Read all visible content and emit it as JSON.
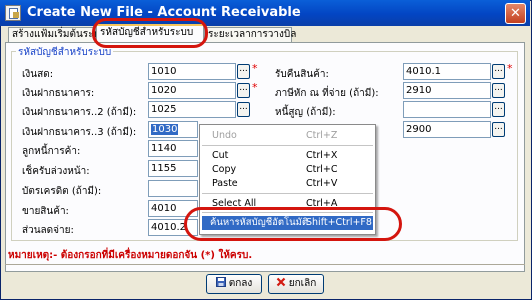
{
  "window": {
    "title": "Create New File - Account Receivable",
    "close_glyph": "✕"
  },
  "tabs": [
    {
      "label": "สร้างแฟ้มเริ่มต้นระบบ"
    },
    {
      "label": "รหัสบัญชีสำหรับระบบ"
    },
    {
      "label": "ระยะเวลาการวางบิล"
    }
  ],
  "group": {
    "title": "รหัสบัญชีสำหรับระบบ"
  },
  "left_fields": [
    {
      "label": "เงินสด:",
      "value": "1010",
      "required_mark": "*"
    },
    {
      "label": "เงินฝากธนาคาร:",
      "value": "1020",
      "required_mark": "*"
    },
    {
      "label": "เงินฝากธนาคาร..2 (ถ้ามี):",
      "value": "1025"
    },
    {
      "label": "เงินฝากธนาคาร..3 (ถ้ามี):",
      "value": "1030"
    },
    {
      "label": "ลูกหนี้การค้า:",
      "value": "1140"
    },
    {
      "label": "เช็ครับล่วงหน้า:",
      "value": "1155"
    },
    {
      "label": "บัตรเครดิต (ถ้ามี):",
      "value": ""
    },
    {
      "label": "ขายสินค้า:",
      "value": "4010"
    },
    {
      "label": "ส่วนลดจ่าย:",
      "value": "4010.2"
    }
  ],
  "right_fields": [
    {
      "label": "รับคืนสินค้า:",
      "value": "4010.1",
      "required_mark": "*"
    },
    {
      "label": "ภาษีหัก ณ ที่จ่าย (ถ้ามี):",
      "value": "2910"
    },
    {
      "label": "หนี้สูญ (ถ้ามี):",
      "value": ""
    },
    {
      "label": "",
      "value": "2900"
    }
  ],
  "dots_label": "...",
  "context_menu": {
    "items": [
      {
        "label": "Undo",
        "shortcut": "Ctrl+Z",
        "disabled": true
      },
      {
        "label": "Cut",
        "shortcut": "Ctrl+X"
      },
      {
        "label": "Copy",
        "shortcut": "Ctrl+C"
      },
      {
        "label": "Paste",
        "shortcut": "Ctrl+V"
      },
      {
        "label": "Select All",
        "shortcut": "Ctrl+A"
      },
      {
        "label": "ค้นหารหัสบัญชีอัตโนมัติ",
        "shortcut": "Shift+Ctrl+F8",
        "highlighted": true
      }
    ]
  },
  "note": "หมายเหตุ:- ต้องกรอกที่มีเครื่องหมายดอกจัน (*) ให้ครบ.",
  "buttons": {
    "ok": "ตกลง",
    "cancel": "ยกเลิก"
  },
  "colors": {
    "title_bar": "#0345c3",
    "highlight": "#316ac5",
    "annotation_ring": "#d4150e",
    "required": "#e00000"
  },
  "icons": {
    "ok": "save-icon",
    "cancel": "cancel-x-icon"
  }
}
